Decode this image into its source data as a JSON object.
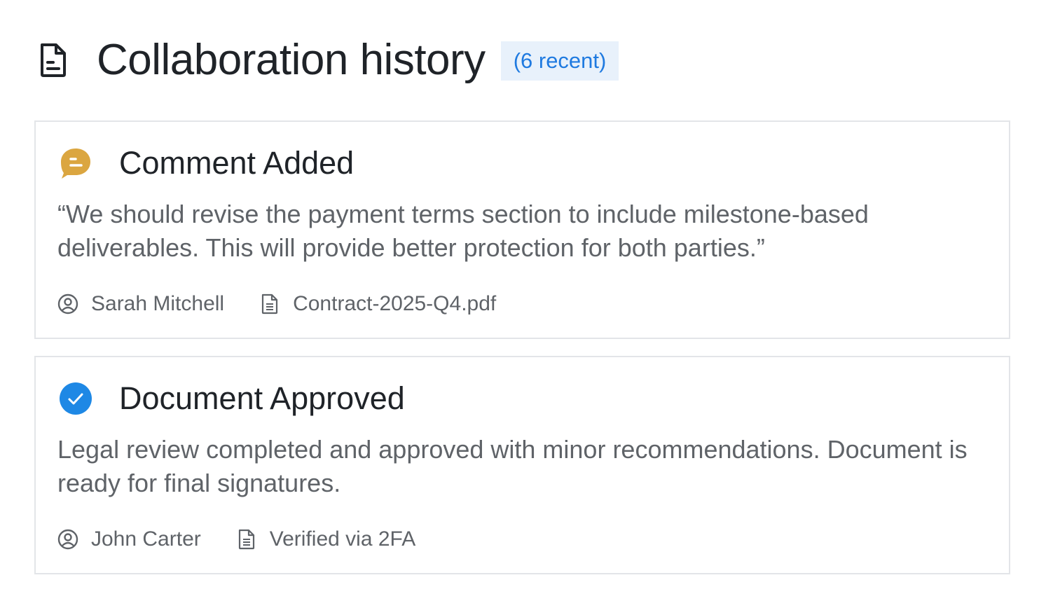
{
  "header": {
    "icon": "document-icon",
    "title": "Collaboration history",
    "badge": "(6 recent)"
  },
  "colors": {
    "accent_blue": "#1f7ae0",
    "comment_orange": "#dba640",
    "approved_blue": "#1e88e5",
    "badge_bg": "#e8f1fb",
    "text_dark": "#1f2328",
    "text_muted": "#5f6368",
    "border": "#e3e5e8"
  },
  "activities": [
    {
      "icon": "comment-bubble-icon",
      "title": "Comment Added",
      "body": "“We should revise the payment terms section to include milestone-based deliverables. This will provide better protection for both parties.”",
      "user_icon": "user-circle-icon",
      "user": "Sarah Mitchell",
      "detail_icon": "file-text-icon",
      "detail": "Contract-2025-Q4.pdf"
    },
    {
      "icon": "check-circle-icon",
      "title": "Document Approved",
      "body": "Legal review completed and approved with minor recommendations. Document is ready for final signatures.",
      "user_icon": "user-circle-icon",
      "user": "John Carter",
      "detail_icon": "file-text-icon",
      "detail": "Verified via 2FA"
    }
  ]
}
